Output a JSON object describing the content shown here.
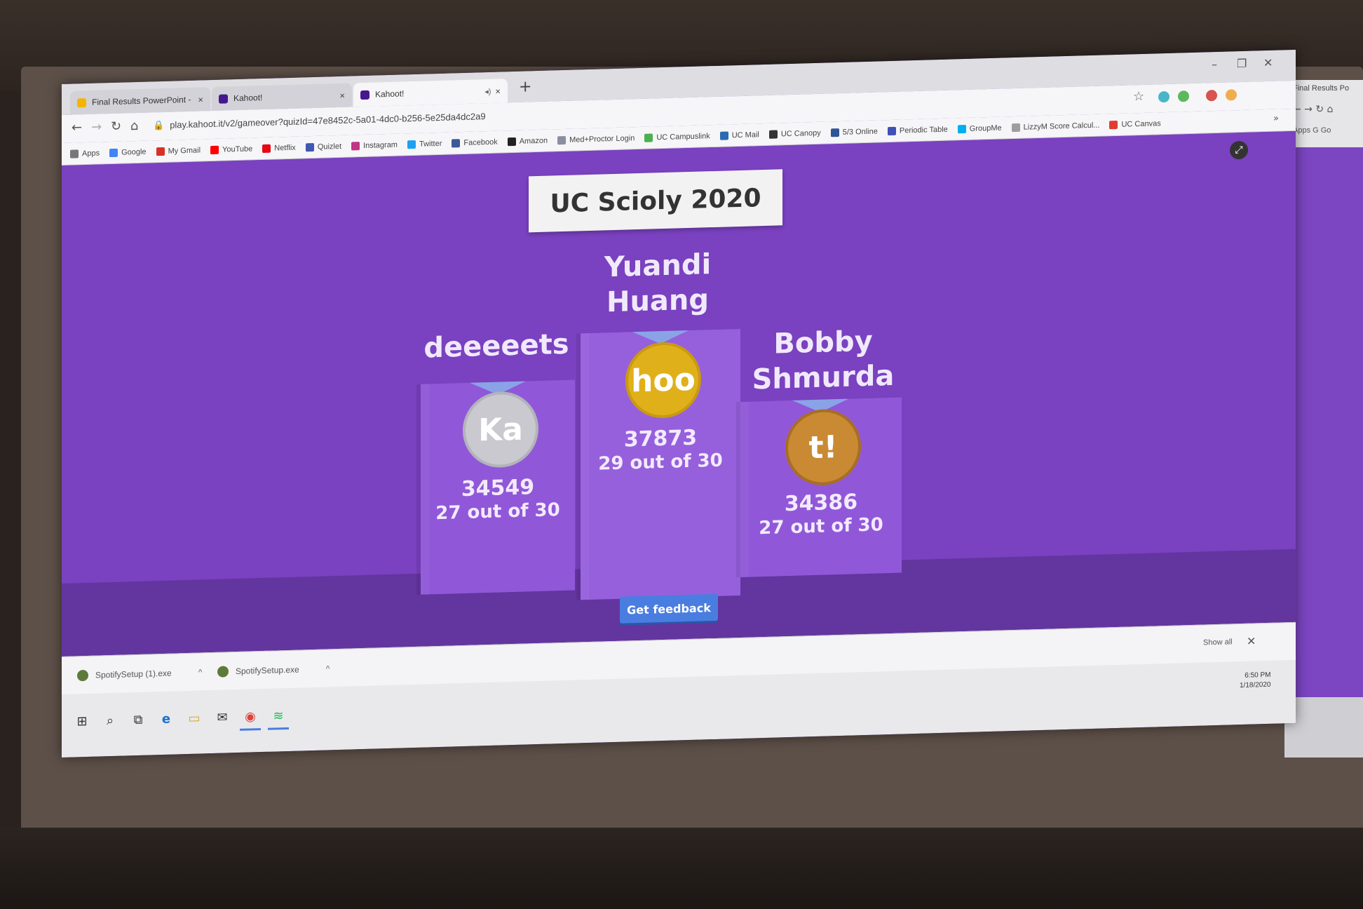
{
  "browser": {
    "tabs": [
      {
        "label": "Final Results PowerPoint - Goog",
        "favicon_color": "#f4b400",
        "close": "×"
      },
      {
        "label": "Kahoot!",
        "favicon_color": "#46178f",
        "close": "×"
      },
      {
        "label": "Kahoot!",
        "favicon_color": "#46178f",
        "close": "×",
        "audio": "◂)"
      }
    ],
    "new_tab": "+",
    "window_controls": {
      "minimize": "–",
      "restore": "❐",
      "close": "✕"
    },
    "nav": {
      "back": "←",
      "forward": "→",
      "reload": "↻",
      "home": "⌂"
    },
    "url": "play.kahoot.it/v2/gameover?quizId=47e8452c-5a01-4dc0-b256-5e25da4dc2a9",
    "bookmark_star": "☆",
    "bookmarks": [
      {
        "label": "Apps",
        "color": "#777777"
      },
      {
        "label": "Google",
        "color": "#4285f4"
      },
      {
        "label": "My Gmail",
        "color": "#d93025"
      },
      {
        "label": "YouTube",
        "color": "#ff0000"
      },
      {
        "label": "Netflix",
        "color": "#e50914"
      },
      {
        "label": "Quizlet",
        "color": "#4257b2"
      },
      {
        "label": "Instagram",
        "color": "#c13584"
      },
      {
        "label": "Twitter",
        "color": "#1da1f2"
      },
      {
        "label": "Facebook",
        "color": "#3b5998"
      },
      {
        "label": "Amazon",
        "color": "#222222"
      },
      {
        "label": "Med+Proctor Login",
        "color": "#8a8fa0"
      },
      {
        "label": "UC Campuslink",
        "color": "#4caf50"
      },
      {
        "label": "UC Mail",
        "color": "#2b6cb0"
      },
      {
        "label": "UC Canopy",
        "color": "#333333"
      },
      {
        "label": "5/3 Online",
        "color": "#2f5597"
      },
      {
        "label": "Periodic Table",
        "color": "#3f51b5"
      },
      {
        "label": "GroupMe",
        "color": "#00aff0"
      },
      {
        "label": "LizzyM Score Calcul...",
        "color": "#9e9e9e"
      },
      {
        "label": "UC Canvas",
        "color": "#e03c31"
      }
    ],
    "bookmarks_more": "»",
    "extension_colors": [
      "#48b6c8",
      "#5cb85c",
      "#d9534f",
      "#f0ad4e"
    ]
  },
  "kahoot": {
    "title": "UC Scioly 2020",
    "fullscreen": "⤢",
    "podium": [
      {
        "place": 2,
        "name": "deeeeets",
        "medal_text": "Ka",
        "medal_color": "#c9c9cf",
        "score": "34549",
        "correct": "27 out of 30"
      },
      {
        "place": 1,
        "name": "Yuandi Huang",
        "medal_text": "hoo",
        "medal_color": "#e0b01b",
        "score": "37873",
        "correct": "29 out of 30"
      },
      {
        "place": 3,
        "name": "Bobby Shmurda",
        "medal_text": "t!",
        "medal_color": "#c98a33",
        "score": "34386",
        "correct": "27 out of 30"
      }
    ],
    "feedback_button": "Get feedback"
  },
  "downloads": {
    "items": [
      {
        "label": "SpotifySetup (1).exe",
        "chevron": "^"
      },
      {
        "label": "SpotifySetup.exe",
        "chevron": "^"
      }
    ],
    "show_all": "Show all",
    "close": "✕"
  },
  "taskbar": {
    "start": "⊞",
    "search": "⌕",
    "task_view": "⧉",
    "edge": "e",
    "explorer": "▭",
    "mail": "✉",
    "chrome": "◉",
    "spotify": "≋",
    "time": "6:50 PM",
    "date": "1/18/2020"
  },
  "side_window": {
    "tab": "Final Results Po",
    "nav": "← → ↻ ⌂",
    "apps": "Apps   G Go"
  }
}
